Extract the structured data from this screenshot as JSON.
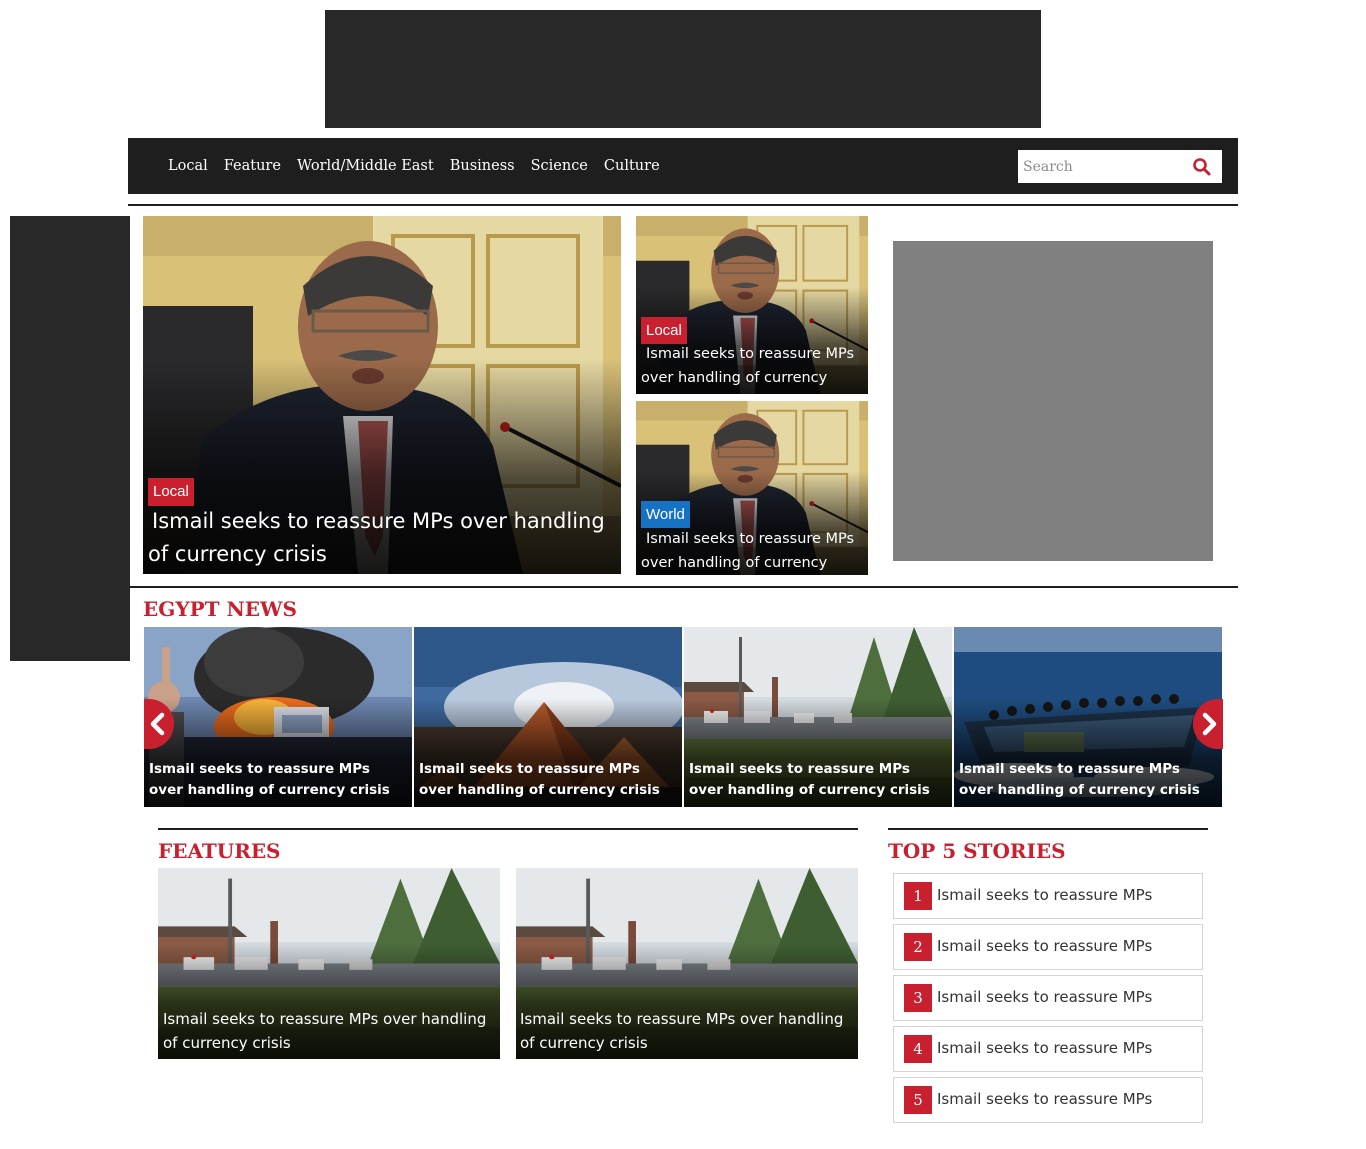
{
  "nav": {
    "items": [
      "Local",
      "Feature",
      "World/Middle East",
      "Business",
      "Science",
      "Culture"
    ],
    "search_placeholder": "Search",
    "search_icon": "search-icon"
  },
  "hero": {
    "main": {
      "tag": "Local",
      "headline": "Ismail seeks to reassure MPs over handling of currency crisis"
    },
    "side": [
      {
        "tag": "Local",
        "headline": "Ismail seeks to reassure MPs over handling of currency crisis"
      },
      {
        "tag": "World",
        "headline": "Ismail seeks to reassure MPs over handling of currency crisis"
      }
    ]
  },
  "egypt_news": {
    "title": "EGYPT NEWS",
    "slides": [
      {
        "caption": "Ismail seeks to reassure MPs over handling of currency crisis"
      },
      {
        "caption": "Ismail seeks to reassure MPs over handling of currency crisis"
      },
      {
        "caption": "Ismail seeks to reassure MPs over handling of currency crisis"
      },
      {
        "caption": "Ismail seeks to reassure MPs over handling of currency crisis"
      }
    ],
    "prev_icon": "chevron-left-icon",
    "next_icon": "chevron-right-icon"
  },
  "features": {
    "title": "FEATURES",
    "items": [
      {
        "caption": "Ismail seeks to reassure MPs over handling of currency crisis"
      },
      {
        "caption": "Ismail seeks to reassure MPs over handling of currency crisis"
      }
    ]
  },
  "top_stories": {
    "title": "TOP 5 STORIES",
    "items": [
      {
        "rank": "1",
        "text": "Ismail seeks to reassure MPs"
      },
      {
        "rank": "2",
        "text": "Ismail seeks to reassure MPs"
      },
      {
        "rank": "3",
        "text": "Ismail seeks to reassure MPs"
      },
      {
        "rank": "4",
        "text": "Ismail seeks to reassure MPs"
      },
      {
        "rank": "5",
        "text": "Ismail seeks to reassure MPs"
      }
    ]
  },
  "colors": {
    "accent": "#c8202f",
    "world_tag": "#1672c4",
    "nav_bg": "#1e1e1e",
    "ad_dark": "#282828",
    "ad_gray": "#808080"
  }
}
